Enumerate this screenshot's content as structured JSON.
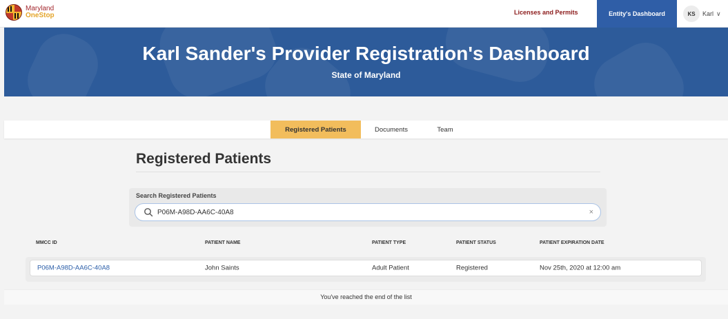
{
  "header": {
    "logo_line1": "Maryland",
    "logo_line2": "OneStop",
    "licenses_link": "Licenses and Permits",
    "dashboard_link": "Entity's Dashboard",
    "user_initials": "KS",
    "user_name": "Karl",
    "chevron": "∨"
  },
  "hero": {
    "title": "Karl Sander's Provider Registration's Dashboard",
    "subtitle": "State of Maryland"
  },
  "tabs": [
    {
      "label": "Registered Patients",
      "active": true
    },
    {
      "label": "Documents",
      "active": false
    },
    {
      "label": "Team",
      "active": false
    }
  ],
  "section": {
    "title": "Registered Patients"
  },
  "search": {
    "label": "Search Registered Patients",
    "value": "P06M-A98D-AA6C-40A8",
    "clear": "×"
  },
  "table": {
    "headers": [
      "MMCC ID",
      "PATIENT NAME",
      "PATIENT TYPE",
      "PATIENT STATUS",
      "PATIENT EXPIRATION DATE"
    ],
    "rows": [
      [
        "P06M-A98D-AA6C-40A8",
        "John Saints",
        "Adult Patient",
        "Registered",
        "Nov 25th, 2020 at 12:00 am"
      ]
    ]
  },
  "footer": {
    "end_text": "You've reached the end of the list"
  },
  "colors": {
    "brand_blue": "#2d5b9a",
    "tab_active": "#f2bd5c",
    "link_red": "#8b1a1a",
    "link_blue": "#2a5da8"
  }
}
